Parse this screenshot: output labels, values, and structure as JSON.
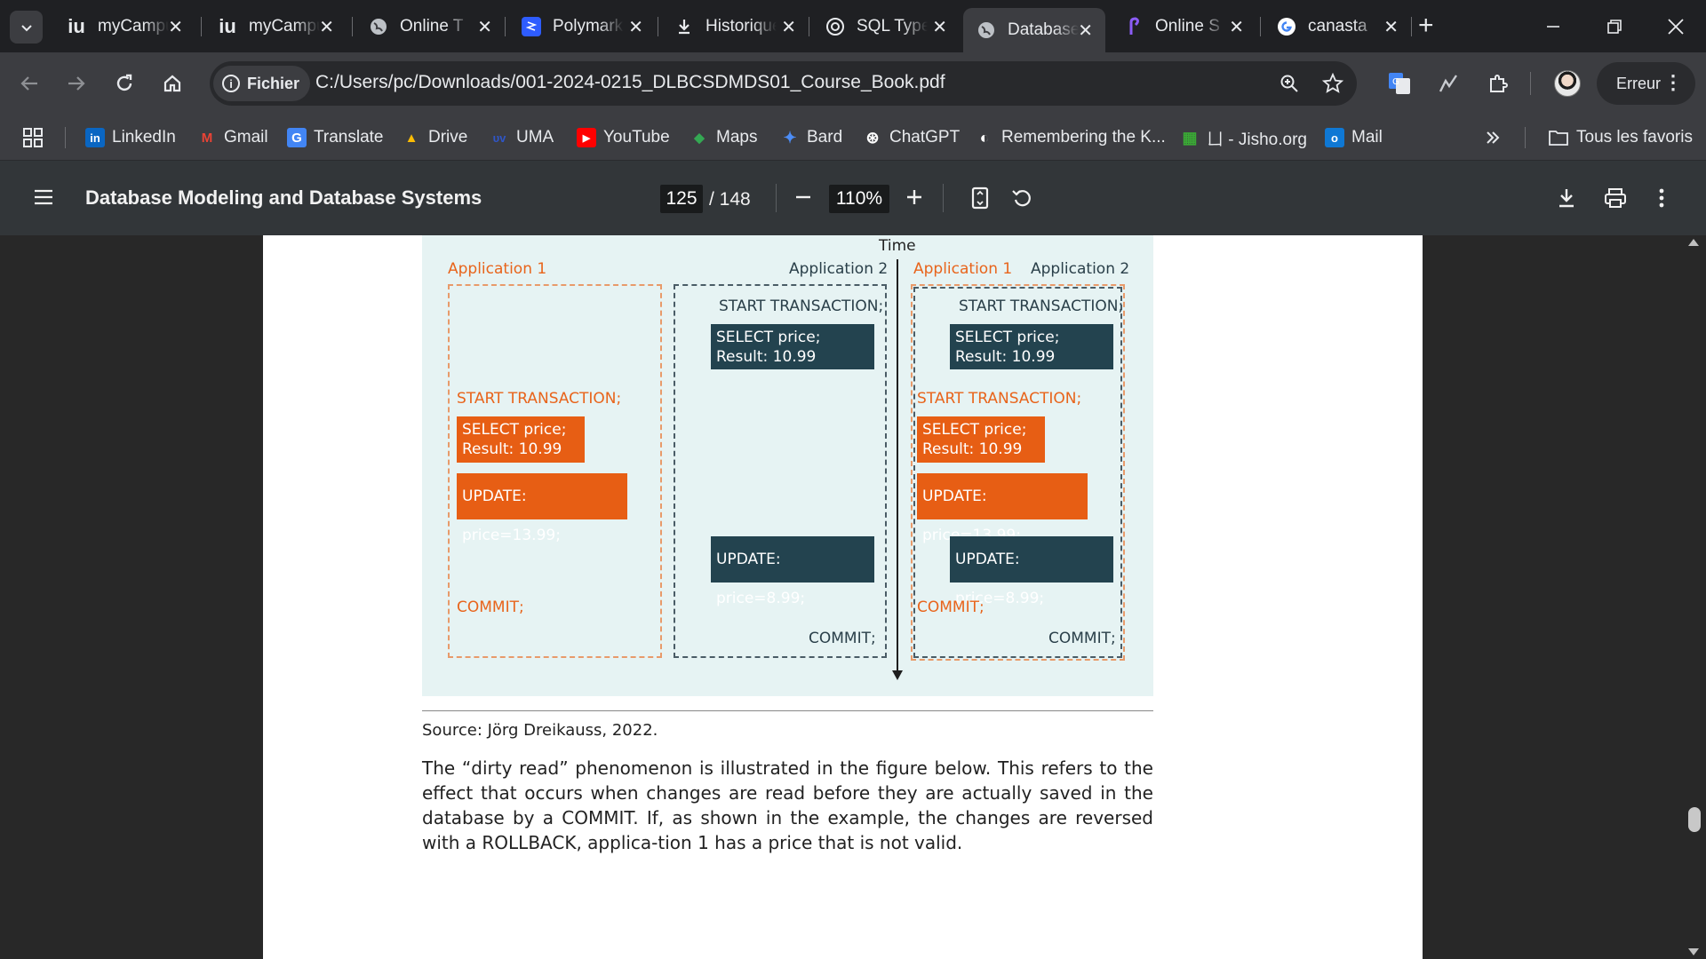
{
  "tabs": [
    {
      "icon": "iu",
      "title": "myCampus",
      "active": false
    },
    {
      "icon": "iu",
      "title": "myCampus",
      "active": false
    },
    {
      "icon": "globe",
      "title": "Online T",
      "active": false
    },
    {
      "icon": "polymarket",
      "title": "Polymarket",
      "active": false
    },
    {
      "icon": "download",
      "title": "Historique",
      "active": false
    },
    {
      "icon": "openai",
      "title": "SQL Types",
      "active": false
    },
    {
      "icon": "globe",
      "title": "Database",
      "active": true
    },
    {
      "icon": "pen",
      "title": "Online S",
      "active": false
    },
    {
      "icon": "google",
      "title": "canasta",
      "active": false
    }
  ],
  "toolbar": {
    "site_chip": "Fichier",
    "url": "C:/Users/pc/Downloads/001-2024-0215_DLBCSDMDS01_Course_Book.pdf",
    "profile_label": "Erreur"
  },
  "bookmarks": [
    {
      "icon": "in",
      "label": "LinkedIn",
      "color": "#0a66c2"
    },
    {
      "icon": "M",
      "label": "Gmail",
      "color": "#ea4335"
    },
    {
      "icon": "G",
      "label": "Translate",
      "color": "#4285f4"
    },
    {
      "icon": "▲",
      "label": "Drive",
      "color": "#1fa463"
    },
    {
      "icon": "ᴜᴠ",
      "label": "UMA",
      "color": "#2f56c8"
    },
    {
      "icon": "▶",
      "label": "YouTube",
      "color": "#ff0000"
    },
    {
      "icon": "◆",
      "label": "Maps",
      "color": "#34a853"
    },
    {
      "icon": "✦",
      "label": "Bard",
      "color": "#4c8df6"
    },
    {
      "icon": "⊛",
      "label": "ChatGPT",
      "color": "#ffffff"
    },
    {
      "icon": "◐",
      "label": "Remembering the K...",
      "color": "#ffffff"
    },
    {
      "icon": "▦",
      "label": "ㄩ - Jisho.org",
      "color": "#3aaa35"
    },
    {
      "icon": "o",
      "label": "Mail",
      "color": "#0f78d4"
    }
  ],
  "bookmarks_all": "Tous les favoris",
  "pdf": {
    "title": "Database Modeling and Database Systems",
    "page_current": "125",
    "page_total": "/ 148",
    "zoom": "110%"
  },
  "figure": {
    "time_label": "Time",
    "left": {
      "app1_label": "Application 1",
      "app2_label": "Application 2",
      "app2_start": "START TRANSACTION;",
      "app2_select": [
        "SELECT price;",
        "Result: 10.99"
      ],
      "app1_start": "START TRANSACTION;",
      "app1_select": [
        "SELECT price;",
        "Result: 10.99"
      ],
      "app1_update": "UPDATE: price=13.99;",
      "app2_update": "UPDATE: price=8.99;",
      "app1_commit": "COMMIT;",
      "app2_commit": "COMMIT;"
    },
    "right": {
      "app1_label": "Application 1",
      "app2_label": "Application 2",
      "app2_start": "START TRANSACTION;",
      "app2_select": [
        "SELECT price;",
        "Result: 10.99"
      ],
      "app1_start": "START TRANSACTION;",
      "app1_select": [
        "SELECT price;",
        "Result: 10.99"
      ],
      "app1_update": "UPDATE: price=13.99;",
      "app2_update": "UPDATE: price=8.99;",
      "app1_commit": "COMMIT;",
      "app2_commit": "COMMIT;"
    }
  },
  "source": "Source: Jörg Dreikauss, 2022.",
  "paragraph": "The “dirty read” phenomenon is illustrated in the figure below. This refers to the effect that occurs when changes are read before they are actually saved in the database by a COMMIT. If, as shown in the example, the changes are reversed with a ROLLBACK, applica-tion 1 has a price that is not valid."
}
